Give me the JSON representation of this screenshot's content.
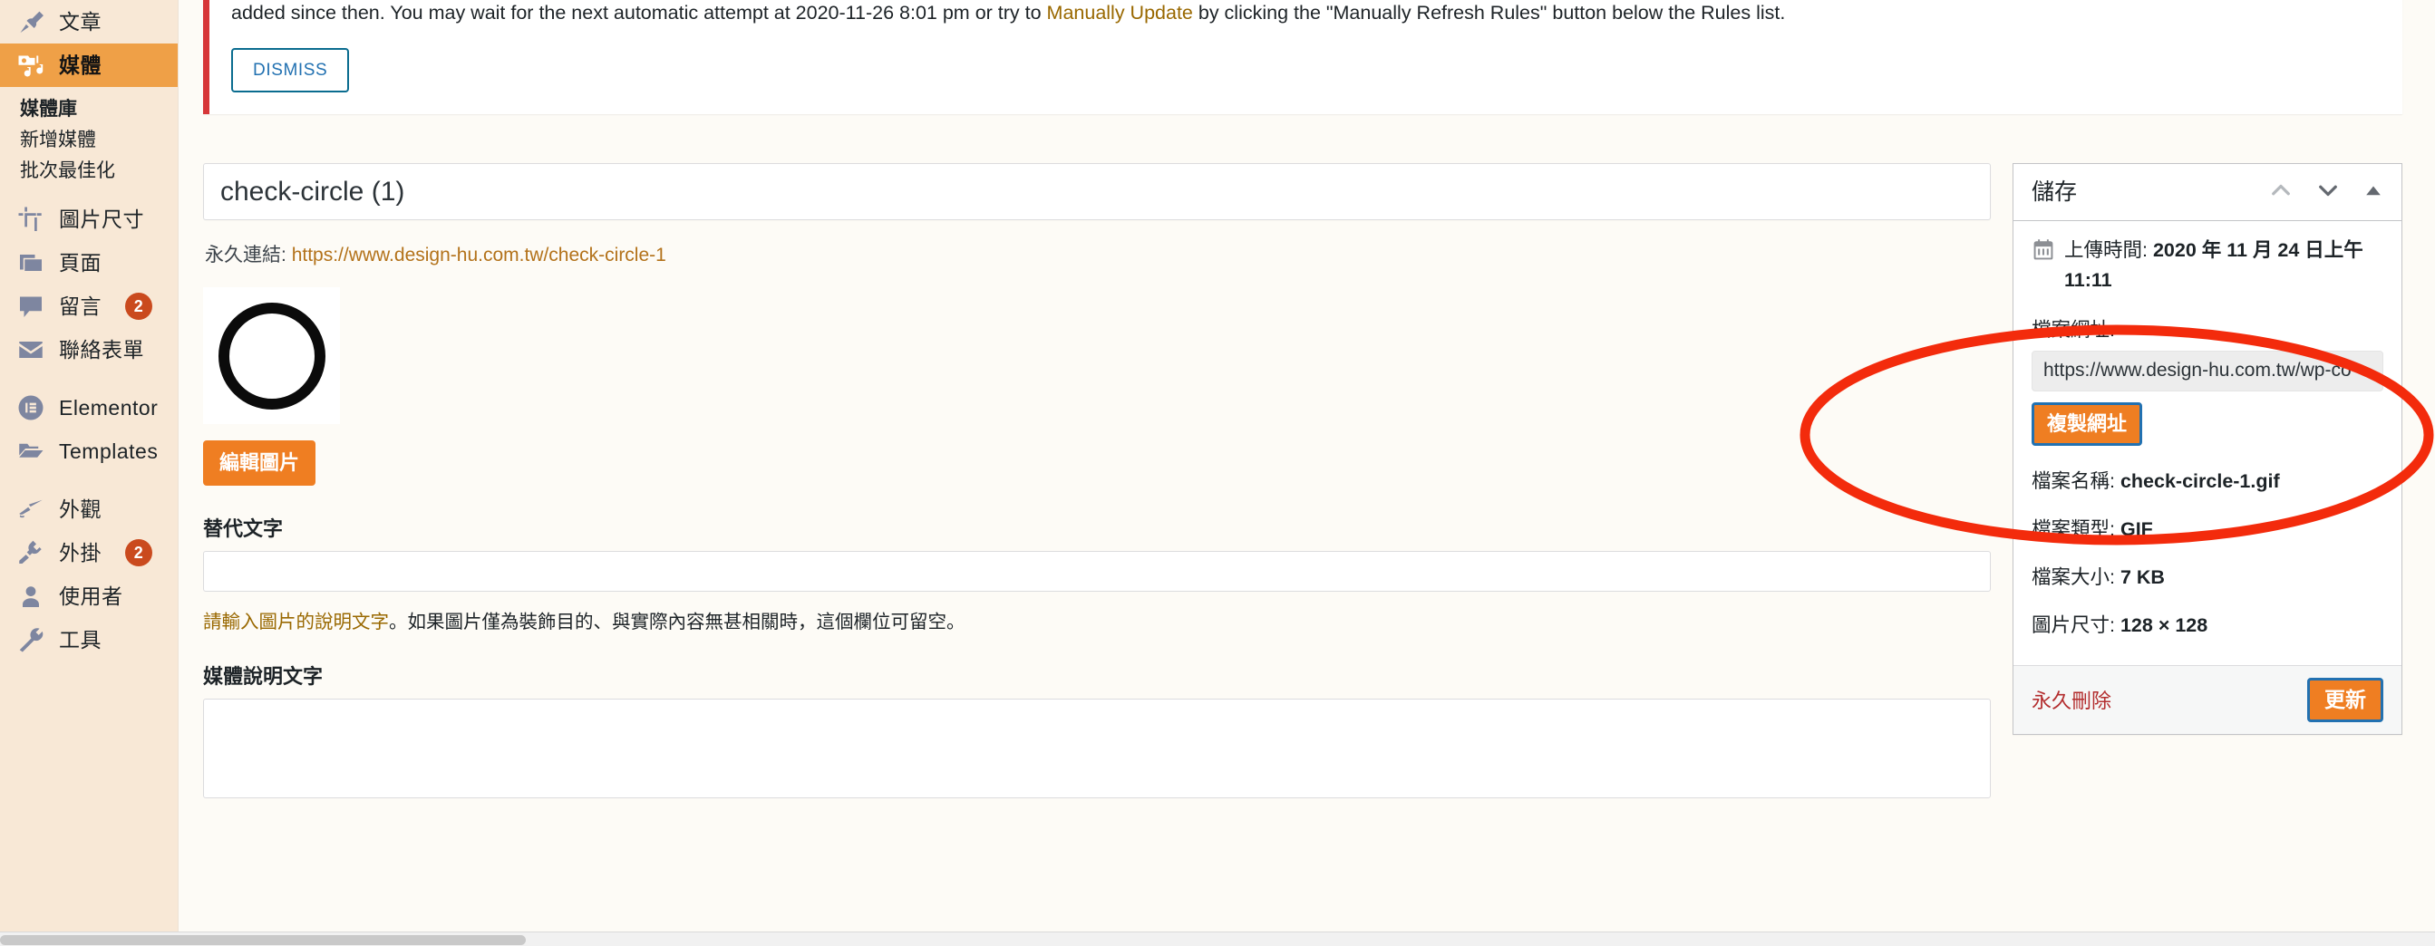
{
  "sidebar": {
    "items": [
      {
        "label": "文章",
        "icon": "pin-icon",
        "badge": null,
        "active": false
      },
      {
        "label": "媒體",
        "icon": "media-camera-icon",
        "badge": null,
        "active": true
      }
    ],
    "submenu": [
      {
        "label": "媒體庫",
        "current": true
      },
      {
        "label": "新增媒體",
        "current": false
      },
      {
        "label": "批次最佳化",
        "current": false
      }
    ],
    "items2": [
      {
        "label": "圖片尺寸",
        "icon": "crop-icon",
        "badge": null
      },
      {
        "label": "頁面",
        "icon": "pages-icon",
        "badge": null
      },
      {
        "label": "留言",
        "icon": "comment-icon",
        "badge": "2"
      },
      {
        "label": "聯絡表單",
        "icon": "envelope-icon",
        "badge": null
      }
    ],
    "items3": [
      {
        "label": "Elementor",
        "icon": "elementor-icon",
        "badge": null
      },
      {
        "label": "Templates",
        "icon": "folder-icon",
        "badge": null
      }
    ],
    "items4": [
      {
        "label": "外觀",
        "icon": "brush-icon",
        "badge": null
      },
      {
        "label": "外掛",
        "icon": "plug-icon",
        "badge": "2"
      },
      {
        "label": "使用者",
        "icon": "user-icon",
        "badge": null
      },
      {
        "label": "工具",
        "icon": "wrench-icon",
        "badge": null
      }
    ]
  },
  "notice": {
    "text_before": "added since then. You may wait for the next automatic attempt at 2020-11-26 8:01 pm or try to ",
    "link": "Manually Update",
    "text_after": " by clicking the \"Manually Refresh Rules\" button below the Rules list.",
    "dismiss_label": "DISMISS"
  },
  "main": {
    "title_value": "check-circle (1)",
    "permalink_label": "永久連結:",
    "permalink_url": "https://www.design-hu.com.tw/check-circle-1",
    "edit_image_label": "編輯圖片",
    "alt_text_label": "替代文字",
    "alt_text_value": "",
    "alt_text_help_highlight": "請輸入圖片的說明文字",
    "alt_text_help_rest": "。如果圖片僅為裝飾目的、與實際內容無甚相關時，這個欄位可留空。",
    "description_label": "媒體說明文字",
    "description_value": ""
  },
  "savebox": {
    "title": "儲存",
    "uploaded_label": "上傳時間:",
    "uploaded_value": "2020 年 11 月 24 日上午 11:11",
    "file_url_label": "檔案網址:",
    "file_url_value": "https://www.design-hu.com.tw/wp-co",
    "copy_url_label": "複製網址",
    "file_name_label": "檔案名稱:",
    "file_name_value": "check-circle-1.gif",
    "file_type_label": "檔案類型:",
    "file_type_value": "GIF",
    "file_size_label": "檔案大小:",
    "file_size_value": "7 KB",
    "dimensions_label": "圖片尺寸:",
    "dimensions_value": "128 × 128",
    "delete_label": "永久刪除",
    "update_label": "更新"
  },
  "colors": {
    "sidebar_bg": "#F8E8D6",
    "sidebar_active": "#EFA047",
    "accent_orange": "#EF7E22",
    "annotation_red": "#F32B0C",
    "notice_red": "#D63638",
    "link_gold": "#996800",
    "delete_red": "#b32d2e",
    "button_border_blue": "#2271b1"
  }
}
